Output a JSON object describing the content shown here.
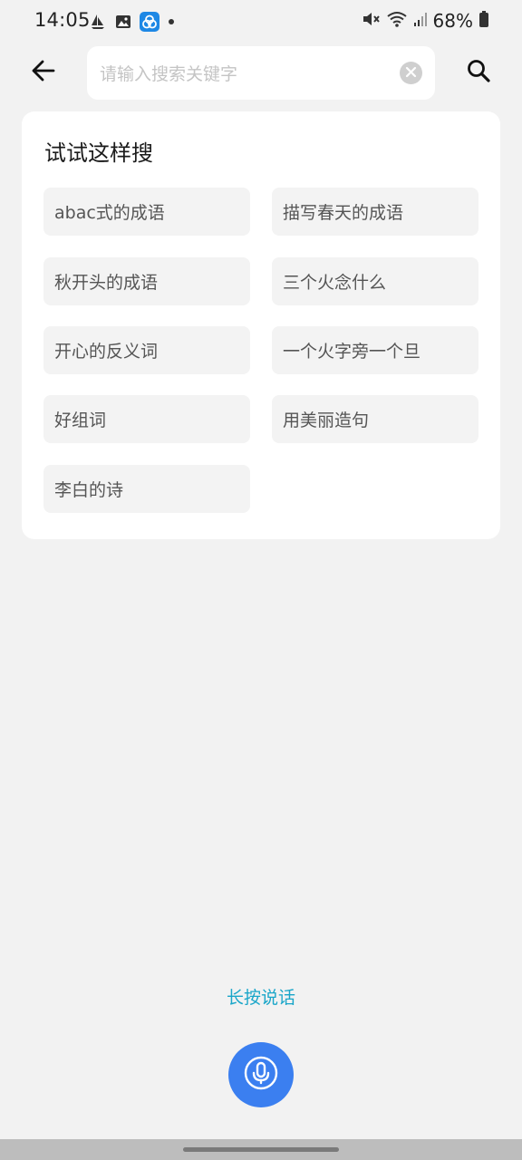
{
  "status_bar": {
    "time": "14:05",
    "battery": "68%"
  },
  "search": {
    "placeholder": "请输入搜索关键字",
    "value": ""
  },
  "suggestions": {
    "title": "试试这样搜",
    "items": [
      "abac式的成语",
      "描写春天的成语",
      "秋开头的成语",
      "三个火念什么",
      "开心的反义词",
      "一个火字旁一个旦",
      "好组词",
      "用美丽造句",
      "李白的诗"
    ]
  },
  "voice": {
    "hint": "长按说话"
  },
  "colors": {
    "background": "#f2f2f2",
    "card": "#ffffff",
    "chip": "#f3f3f3",
    "accent_text": "#1aa6c9",
    "mic_button": "#3b7ff0"
  },
  "icons": {
    "back": "arrow-left-icon",
    "clear": "clear-circle-icon",
    "search": "search-icon",
    "mic": "microphone-icon"
  }
}
